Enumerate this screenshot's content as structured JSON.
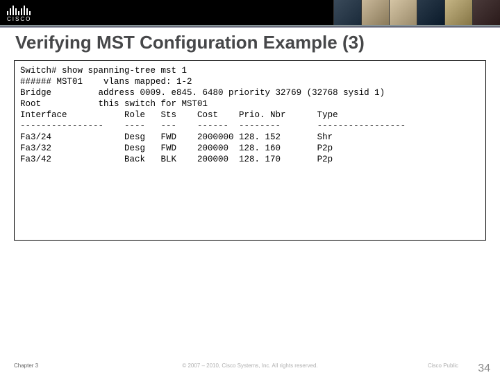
{
  "logo_text": "CISCO",
  "title": "Verifying MST Configuration Example (3)",
  "terminal": {
    "cmd": "Switch# show spanning-tree mst 1",
    "inst": "###### MST01    vlans mapped: 1-2",
    "bridge": "Bridge         address 0009. e845. 6480 priority 32769 (32768 sysid 1)",
    "root": "Root           this switch for MST01",
    "hdr": "Interface           Role   Sts    Cost    Prio. Nbr      Type",
    "sep": "----------------    ----   ---    ------  --------       -----------------",
    "r1": "Fa3/24              Desg   FWD    2000000 128. 152       Shr",
    "r2": "Fa3/32              Desg   FWD    200000  128. 160       P2p",
    "r3": "Fa3/42              Back   BLK    200000  128. 170       P2p"
  },
  "footer": {
    "chapter": "Chapter 3",
    "copyright": "© 2007 – 2010, Cisco Systems, Inc. All rights reserved.",
    "pub": "Cisco Public",
    "page": "34"
  }
}
